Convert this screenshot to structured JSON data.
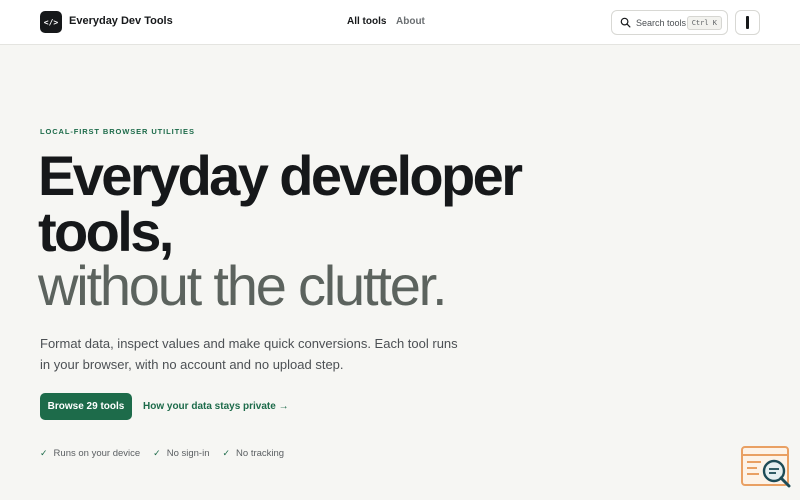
{
  "header": {
    "logo_text": "</>",
    "brand": "Everyday Dev Tools",
    "nav": [
      {
        "label": "All tools",
        "active": true
      },
      {
        "label": "About",
        "active": false
      }
    ],
    "search": {
      "label": "Search tools",
      "shortcut": "Ctrl K",
      "icon": "search-icon"
    },
    "menu_icon": "menu-icon"
  },
  "hero": {
    "eyebrow": "LOCAL-FIRST BROWSER UTILITIES",
    "title_line1": "Everyday developer",
    "title_line2": "tools,",
    "title_line3": "without the clutter.",
    "description": "Format data, inspect values and make quick conversions. Each tool runs in your browser, with no account and no upload step.",
    "cta_label": "Browse 29 tools",
    "link_label": "How your data stays private →",
    "features": [
      "Runs on your device",
      "No sign-in",
      "No tracking"
    ]
  },
  "colors": {
    "accent": "#1d6b4a",
    "text": "#16181a",
    "muted": "#5c635e",
    "background": "#f6f6f3"
  },
  "widget_icon": "browser-search-icon"
}
